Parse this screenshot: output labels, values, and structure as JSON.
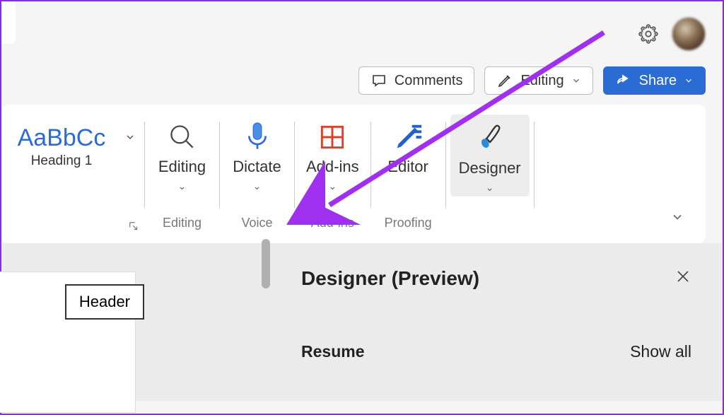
{
  "topbar": {
    "settings_icon": "gear-icon"
  },
  "toolbar": {
    "comments_label": "Comments",
    "editing_label": "Editing",
    "share_label": "Share"
  },
  "ribbon": {
    "style": {
      "sample": "AaBbCc",
      "name": "Heading 1"
    },
    "groups": {
      "editing": {
        "btn_label": "Editing",
        "group_label": "Editing"
      },
      "voice": {
        "btn_label": "Dictate",
        "group_label": "Voice"
      },
      "addins": {
        "btn_label": "Add-ins",
        "group_label": "Add-ins"
      },
      "proofing": {
        "btn_label": "Editor",
        "group_label": "Proofing"
      },
      "designer": {
        "btn_label": "Designer"
      }
    }
  },
  "document": {
    "header_label": "Header"
  },
  "designer_pane": {
    "title": "Designer (Preview)",
    "section": "Resume",
    "show_all": "Show all"
  },
  "annotation": {
    "arrow_color": "#a030f0"
  }
}
